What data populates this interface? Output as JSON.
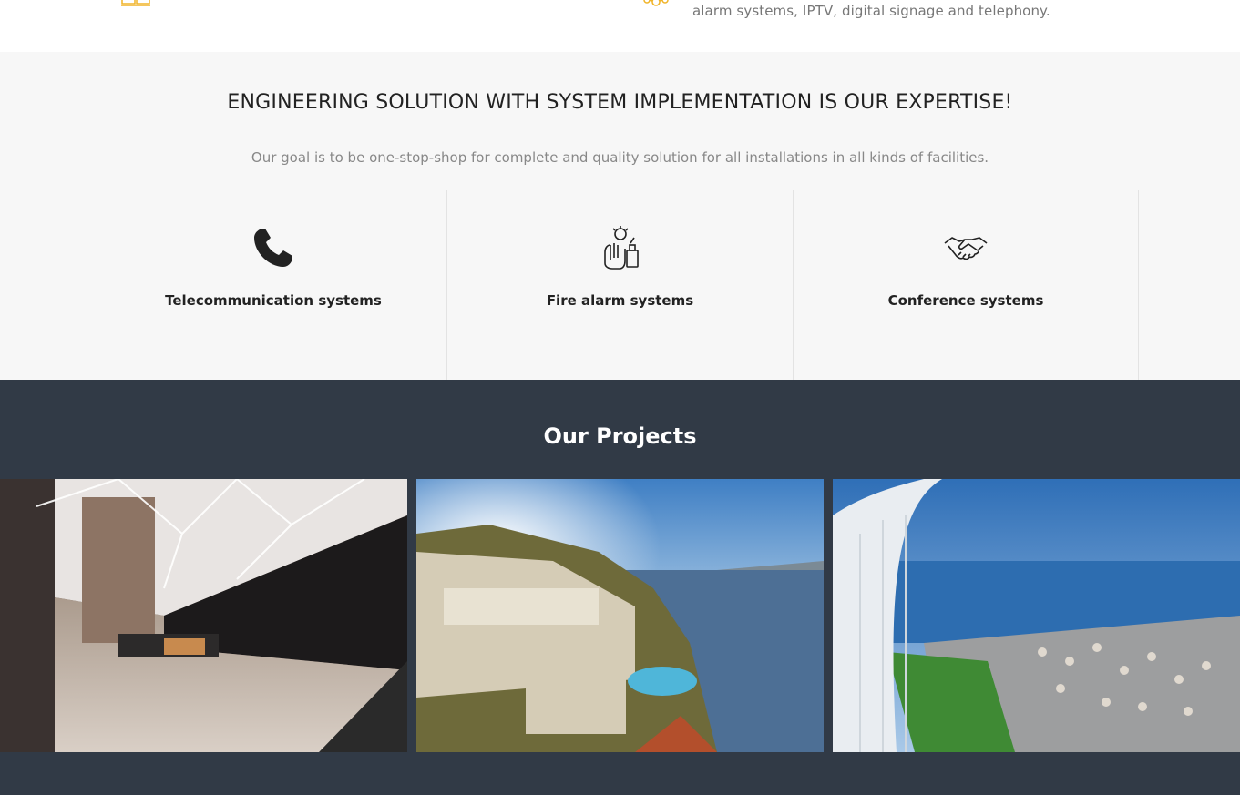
{
  "top": {
    "text": "alarm systems, IPTV, digital signage and telephony."
  },
  "expertise": {
    "title": "ENGINEERING SOLUTION WITH SYSTEM IMPLEMENTATION IS OUR EXPERTISE!",
    "subtitle": "Our goal is to be one-stop-shop for complete and quality solution for all installations in all kinds of facilities.",
    "items": [
      {
        "label": "Telecommunication systems",
        "icon": "phone-icon"
      },
      {
        "label": "Fire alarm systems",
        "icon": "fire-alarm-icon"
      },
      {
        "label": "Conference systems",
        "icon": "handshake-icon"
      }
    ]
  },
  "projects": {
    "title": "Our Projects",
    "images": [
      "hotel-lobby-image",
      "coastal-hotel-image",
      "beach-terrace-image"
    ]
  },
  "colors": {
    "accent": "#f0b429",
    "dark": "#313a46",
    "light_bg": "#f7f7f7"
  }
}
